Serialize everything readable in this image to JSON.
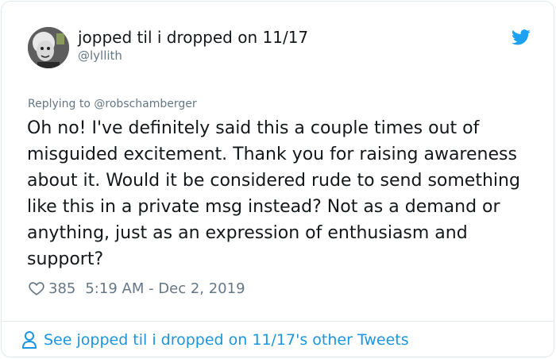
{
  "author": {
    "display_name": "jopped til i dropped on 11/17",
    "handle": "@lyllith"
  },
  "reply_context": "Replying to @robschamberger",
  "tweet_text": "Oh no! I've definitely said this a couple times out of misguided excitement. Thank you for raising awareness about it. Would it be considered rude to send something like this in a private msg instead? Not as a demand or anything, just as an expression of enthusiasm and support?",
  "meta": {
    "likes": "385",
    "timestamp": "5:19 AM - Dec 2, 2019"
  },
  "footer": {
    "link_text": "See jopped til i dropped on 11/17's other Tweets"
  },
  "icons": {
    "brand": "twitter-bird-icon",
    "like": "heart-icon",
    "profile": "person-icon"
  },
  "colors": {
    "accent": "#1da1f2",
    "link": "#1b95e0",
    "muted": "#657786",
    "text": "#14171a",
    "border": "#e1e8ed"
  }
}
